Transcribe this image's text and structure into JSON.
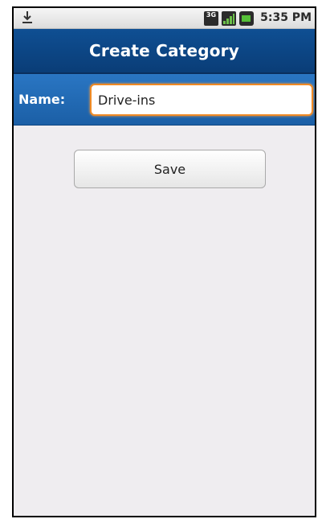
{
  "status_bar": {
    "time": "5:35 PM",
    "icons": [
      "download-icon",
      "3g-icon",
      "signal-icon",
      "battery-icon"
    ],
    "network_label": "3G"
  },
  "title_bar": {
    "title": "Create Category"
  },
  "form": {
    "name_label": "Name:",
    "name_value": "Drive-ins",
    "save_label": "Save"
  },
  "colors": {
    "title_bar": "#0f4f93",
    "name_bar": "#2a76c3",
    "input_focus_border": "#f08a24",
    "background": "#efedf0"
  }
}
